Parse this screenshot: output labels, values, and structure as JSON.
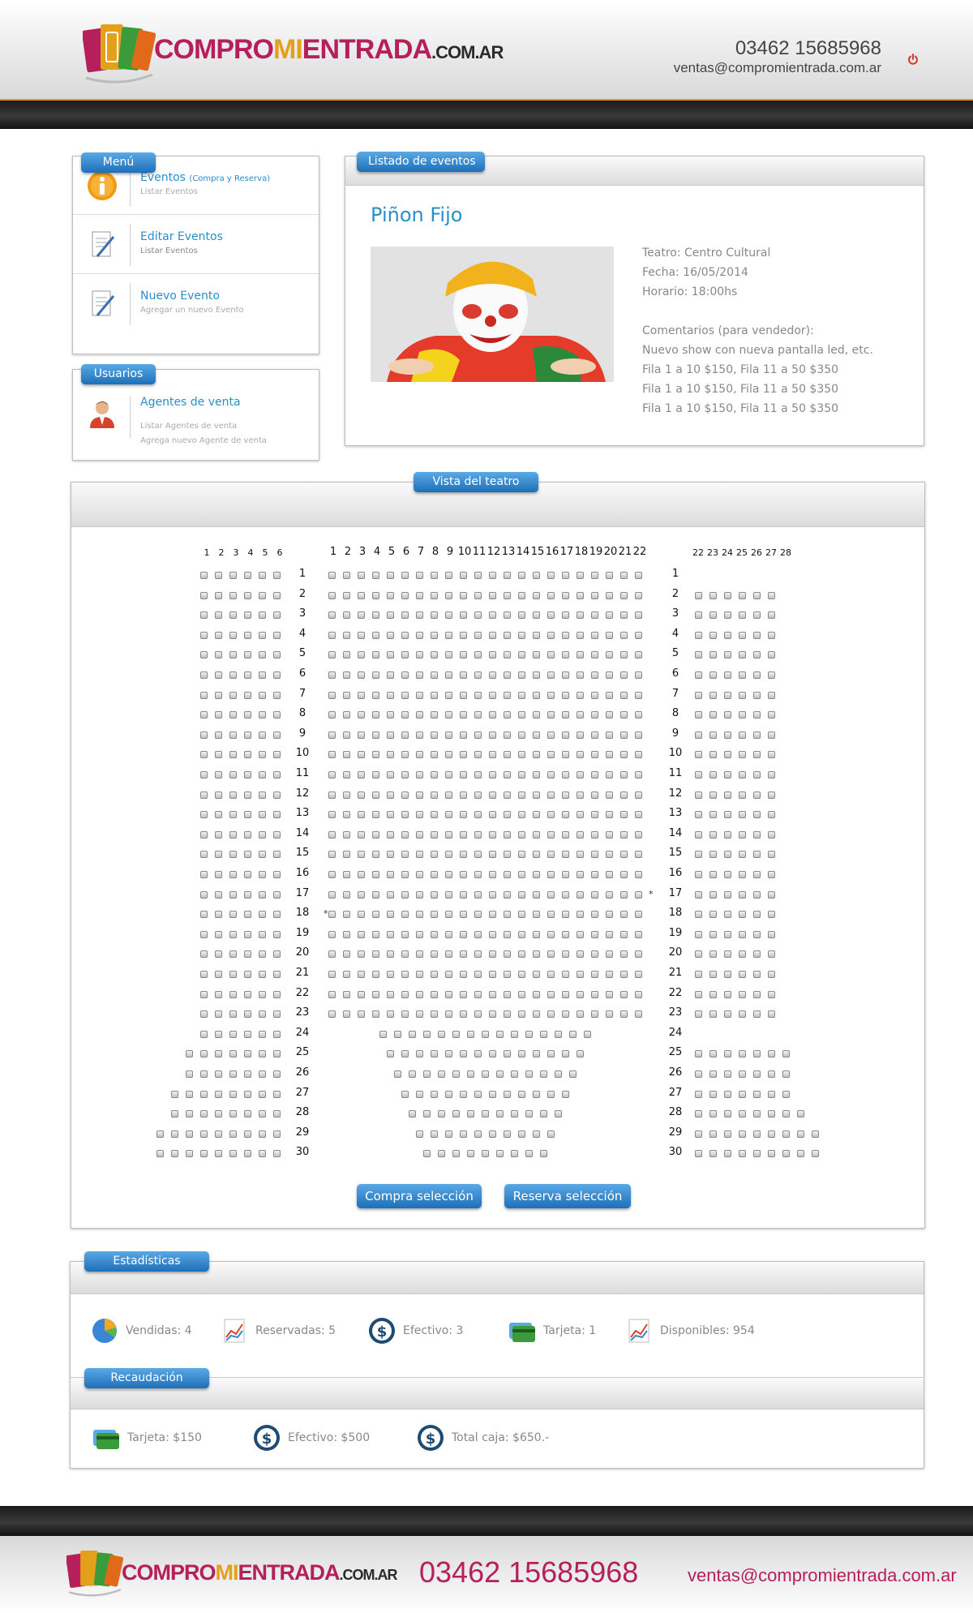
{
  "brand": {
    "part1": "COMPRO",
    "part2": "MI",
    "part3": "ENTRADA",
    "part4": ".COM.AR"
  },
  "header": {
    "phone": "03462 15685968",
    "email": "ventas@compromientrada.com.ar",
    "power_icon": "power-icon"
  },
  "menu": {
    "label": "Menú",
    "items": [
      {
        "title": "Eventos",
        "title_extra": "(Compra y Reserva)",
        "subtitles": [
          "Listar Eventos"
        ],
        "icon": "info-icon"
      },
      {
        "title": "Editar Eventos",
        "title_extra": "",
        "subtitles": [
          "Listar Eventos"
        ],
        "icon": "edit-document-icon"
      },
      {
        "title": "Nuevo Evento",
        "title_extra": "",
        "subtitles": [
          "Agregar un nuevo Evento"
        ],
        "icon": "new-document-icon"
      }
    ]
  },
  "users": {
    "label": "Usuarios",
    "items": [
      {
        "title": "Agentes de venta",
        "subtitles": [
          "Listar Agentes de venta",
          "Agrega nuevo Agente de venta"
        ],
        "icon": "user-icon"
      }
    ]
  },
  "events": {
    "label": "Listado de eventos",
    "title": "Piñon Fijo",
    "details": [
      "Teatro: Centro Cultural",
      "Fecha: 16/05/2014",
      "Horario: 18:00hs"
    ],
    "comments": [
      "Comentarios (para vendedor):",
      "Nuevo show con nueva pantalla led, etc.",
      "Fila 1 a 10 $150, Fila 11 a 50 $350",
      "Fila 1 a 10 $150, Fila 11 a 50 $350",
      "Fila 1 a 10 $150, Fila 11 a 50 $350"
    ]
  },
  "theater": {
    "label": "Vista del teatro",
    "left_headers": [
      "1",
      "2",
      "3",
      "4",
      "5",
      "6"
    ],
    "center_headers": [
      "1",
      "2",
      "3",
      "4",
      "5",
      "6",
      "7",
      "8",
      "9",
      "10",
      "11",
      "12",
      "13",
      "14",
      "15",
      "16",
      "17",
      "18",
      "19",
      "20",
      "21",
      "22"
    ],
    "right_headers": [
      "22",
      "23",
      "24",
      "25",
      "26",
      "27",
      "28"
    ],
    "row_labels": [
      "1",
      "2",
      "3",
      "4",
      "5",
      "6",
      "7",
      "8",
      "9",
      "10",
      "11",
      "12",
      "13",
      "14",
      "15",
      "16",
      "17",
      "18",
      "19",
      "20",
      "21",
      "22",
      "23",
      "24",
      "25",
      "26",
      "27",
      "28",
      "29",
      "30"
    ],
    "left_counts": [
      6,
      6,
      6,
      6,
      6,
      6,
      6,
      6,
      6,
      6,
      6,
      6,
      6,
      6,
      6,
      6,
      6,
      6,
      6,
      6,
      6,
      6,
      6,
      6,
      7,
      7,
      8,
      8,
      9,
      9
    ],
    "center_counts": [
      22,
      22,
      22,
      22,
      22,
      22,
      22,
      22,
      22,
      22,
      22,
      22,
      22,
      22,
      22,
      22,
      22,
      22,
      22,
      22,
      22,
      22,
      22,
      15,
      14,
      13,
      12,
      11,
      10,
      9
    ],
    "right_counts": [
      0,
      6,
      6,
      6,
      6,
      6,
      6,
      6,
      6,
      6,
      6,
      6,
      6,
      6,
      6,
      6,
      6,
      6,
      6,
      6,
      6,
      6,
      6,
      0,
      7,
      7,
      7,
      8,
      9,
      9
    ],
    "buy_button": "Compra selección",
    "reserve_button": "Reserva selección"
  },
  "stats": {
    "label": "Estadísticas",
    "items": [
      {
        "text": "Vendidas: 4",
        "icon": "pie-chart-icon"
      },
      {
        "text": "Reservadas: 5",
        "icon": "line-chart-icon"
      },
      {
        "text": "Efectivo: 3",
        "icon": "cash-icon"
      },
      {
        "text": "Tarjeta: 1",
        "icon": "credit-card-icon"
      },
      {
        "text": "Disponibles: 954",
        "icon": "line-chart-icon"
      }
    ]
  },
  "collection": {
    "label": "Recaudación",
    "items": [
      {
        "text": "Tarjeta: $150",
        "icon": "credit-card-icon"
      },
      {
        "text": "Efectivo: $500",
        "icon": "cash-icon"
      },
      {
        "text": "Total caja: $650.-",
        "icon": "cash-icon"
      }
    ]
  },
  "footer": {
    "phone": "03462 15685968",
    "email": "ventas@compromientrada.com.ar"
  },
  "colors": {
    "accent_blue": "#2a8fc9",
    "button_blue": "#1d6fb8",
    "brand_magenta": "#b5205a",
    "brand_gold": "#e3a01a",
    "header_stripe": "#ff8a1f"
  }
}
